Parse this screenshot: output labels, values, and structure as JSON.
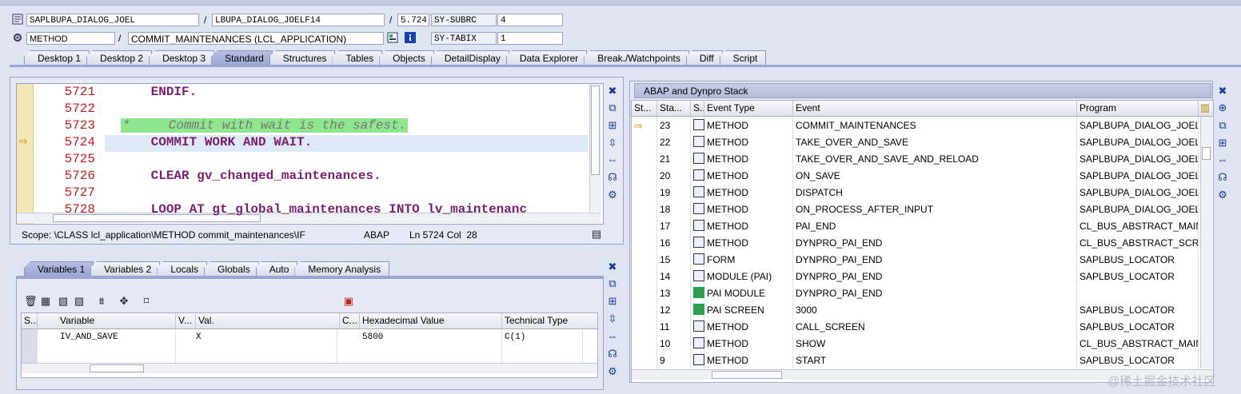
{
  "header": {
    "program": "SAPLBUPA_DIALOG_JOEL",
    "include": "LBUPA_DIALOG_JOELF14",
    "line_no": "5.724",
    "sy1_label": "SY-SUBRC",
    "sy1_value": "4",
    "event_type": "METHOD",
    "event_name": "COMMIT_MAINTENANCES (LCL_APPLICATION)",
    "sy2_label": "SY-TABIX",
    "sy2_value": "1",
    "slash": "/"
  },
  "main_tabs": [
    "Desktop 1",
    "Desktop 2",
    "Desktop 3",
    "Standard",
    "Structures",
    "Tables",
    "Objects",
    "DetailDisplay",
    "Data Explorer",
    "Break./Watchpoints",
    "Diff",
    "Script"
  ],
  "active_main_tab": 3,
  "code": {
    "lines": [
      {
        "num": "5721",
        "text": "      ENDIF."
      },
      {
        "num": "5722",
        "text": ""
      },
      {
        "num": "5723",
        "text": "*     Commit with wait is the safest."
      },
      {
        "num": "5724",
        "text": "      COMMIT WORK AND WAIT."
      },
      {
        "num": "5725",
        "text": ""
      },
      {
        "num": "5726",
        "text": "      CLEAR gv_changed_maintenances."
      },
      {
        "num": "5727",
        "text": ""
      },
      {
        "num": "5728",
        "text": "      LOOP AT gt_global_maintenances INTO lv_maintenanc"
      }
    ],
    "current_marker": "⇨"
  },
  "status_bar": {
    "scope": "Scope: \\CLASS lcl_application\\METHOD commit_maintenances\\IF",
    "lang": "ABAP",
    "pos": "Ln 5724 Col  28"
  },
  "var_tabs": [
    "Variables 1",
    "Variables 2",
    "Locals",
    "Globals",
    "Auto",
    "Memory Analysis"
  ],
  "active_var_tab": 0,
  "variables": {
    "headers": [
      "S...",
      "Variable",
      "V...",
      "Val.",
      "C...",
      "Hexadecimal Value",
      "Technical Type"
    ],
    "rows": [
      {
        "name": "IV_AND_SAVE",
        "val": "X",
        "hex": "5800",
        "type": "C(1)"
      },
      {
        "name": "",
        "val": "",
        "hex": "",
        "type": ""
      }
    ]
  },
  "stack": {
    "title": "ABAP and Dynpro Stack",
    "headers": [
      "St...",
      "Sta...",
      "S...",
      "Event Type",
      "Event",
      "Program"
    ],
    "rows": [
      {
        "level": "23",
        "etype": "METHOD",
        "event": "COMMIT_MAINTENANCES",
        "program": "SAPLBUPA_DIALOG_JOEL",
        "current": "⇨",
        "icon": "code"
      },
      {
        "level": "22",
        "etype": "METHOD",
        "event": "TAKE_OVER_AND_SAVE",
        "program": "SAPLBUPA_DIALOG_JOEL",
        "current": "",
        "icon": "code"
      },
      {
        "level": "21",
        "etype": "METHOD",
        "event": "TAKE_OVER_AND_SAVE_AND_RELOAD",
        "program": "SAPLBUPA_DIALOG_JOEL",
        "current": "",
        "icon": "code"
      },
      {
        "level": "20",
        "etype": "METHOD",
        "event": "ON_SAVE",
        "program": "SAPLBUPA_DIALOG_JOEL",
        "current": "",
        "icon": "code"
      },
      {
        "level": "19",
        "etype": "METHOD",
        "event": "DISPATCH",
        "program": "SAPLBUPA_DIALOG_JOEL",
        "current": "",
        "icon": "code"
      },
      {
        "level": "18",
        "etype": "METHOD",
        "event": "ON_PROCESS_AFTER_INPUT",
        "program": "SAPLBUPA_DIALOG_JOEL",
        "current": "",
        "icon": "code"
      },
      {
        "level": "17",
        "etype": "METHOD",
        "event": "PAI_END",
        "program": "CL_BUS_ABSTRACT_MAIN_",
        "current": "",
        "icon": "code"
      },
      {
        "level": "16",
        "etype": "METHOD",
        "event": "DYNPRO_PAI_END",
        "program": "CL_BUS_ABSTRACT_SCREE",
        "current": "",
        "icon": "code"
      },
      {
        "level": "15",
        "etype": "FORM",
        "event": "DYNPRO_PAI_END",
        "program": "SAPLBUS_LOCATOR",
        "current": "",
        "icon": "code"
      },
      {
        "level": "14",
        "etype": "MODULE (PAI)",
        "event": "DYNPRO_PAI_END",
        "program": "SAPLBUS_LOCATOR",
        "current": "",
        "icon": "code"
      },
      {
        "level": "13",
        "etype": "PAI MODULE",
        "event": "DYNPRO_PAI_END",
        "program": "",
        "current": "",
        "icon": "screen"
      },
      {
        "level": "12",
        "etype": "PAI SCREEN",
        "event": "3000",
        "program": "SAPLBUS_LOCATOR",
        "current": "",
        "icon": "screen"
      },
      {
        "level": "11",
        "etype": "METHOD",
        "event": "CALL_SCREEN",
        "program": "SAPLBUS_LOCATOR",
        "current": "",
        "icon": "code"
      },
      {
        "level": "10",
        "etype": "METHOD",
        "event": "SHOW",
        "program": "CL_BUS_ABSTRACT_MAIN_",
        "current": "",
        "icon": "code"
      },
      {
        "level": "9",
        "etype": "METHOD",
        "event": "START",
        "program": "SAPLBUS_LOCATOR",
        "current": "",
        "icon": "code"
      }
    ]
  },
  "watermark": "@稀土掘金技术社区",
  "colors": {
    "keyword": "#7a1f6e",
    "line_number": "#c02020",
    "comment_bg": "#8ee68e",
    "active_tab": "#9aa6d6"
  }
}
